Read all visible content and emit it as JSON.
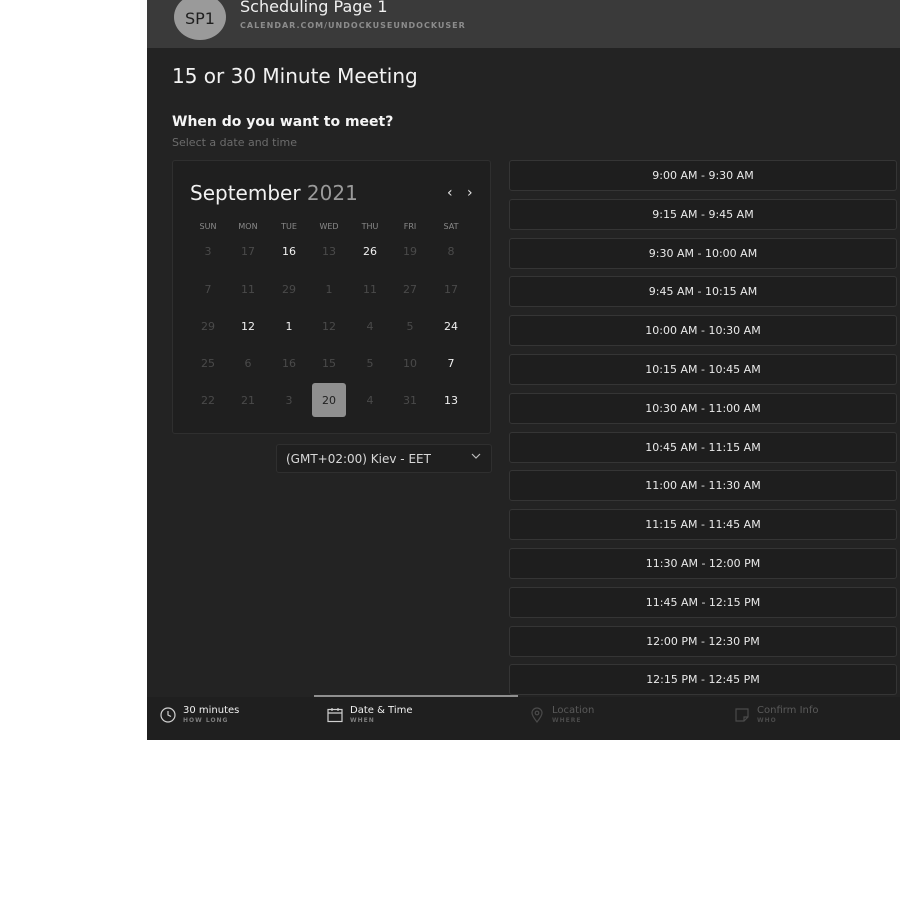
{
  "header": {
    "avatar_initials": "SP1",
    "title": "Scheduling Page 1",
    "url": "CALENDAR.COM/UNDOCKUSEUNDOCKUSER"
  },
  "page_title": "15 or 30 Minute Meeting",
  "question": "When do you want to meet?",
  "subtitle": "Select a date and time",
  "calendar": {
    "month": "September",
    "year": "2021",
    "prev_icon": "‹",
    "next_icon": "›",
    "weekdays": [
      "SUN",
      "MON",
      "TUE",
      "WED",
      "THU",
      "FRI",
      "SAT"
    ],
    "selected": "20",
    "weeks": [
      [
        {
          "d": "3",
          "a": false
        },
        {
          "d": "17",
          "a": false
        },
        {
          "d": "16",
          "a": true
        },
        {
          "d": "13",
          "a": false
        },
        {
          "d": "26",
          "a": true
        },
        {
          "d": "19",
          "a": false
        },
        {
          "d": "8",
          "a": false
        }
      ],
      [
        {
          "d": "7",
          "a": false
        },
        {
          "d": "11",
          "a": false
        },
        {
          "d": "29",
          "a": false
        },
        {
          "d": "1",
          "a": false
        },
        {
          "d": "11",
          "a": false
        },
        {
          "d": "27",
          "a": false
        },
        {
          "d": "17",
          "a": false
        }
      ],
      [
        {
          "d": "29",
          "a": false
        },
        {
          "d": "12",
          "a": true
        },
        {
          "d": "1",
          "a": true
        },
        {
          "d": "12",
          "a": false
        },
        {
          "d": "4",
          "a": false
        },
        {
          "d": "5",
          "a": false
        },
        {
          "d": "24",
          "a": true
        }
      ],
      [
        {
          "d": "25",
          "a": false
        },
        {
          "d": "6",
          "a": false
        },
        {
          "d": "16",
          "a": false
        },
        {
          "d": "15",
          "a": false
        },
        {
          "d": "5",
          "a": false
        },
        {
          "d": "10",
          "a": false
        },
        {
          "d": "7",
          "a": true
        }
      ],
      [
        {
          "d": "22",
          "a": false
        },
        {
          "d": "21",
          "a": false
        },
        {
          "d": "3",
          "a": false
        },
        {
          "d": "20",
          "a": true,
          "s": true
        },
        {
          "d": "4",
          "a": false
        },
        {
          "d": "31",
          "a": false
        },
        {
          "d": "13",
          "a": true
        }
      ]
    ]
  },
  "timezone": {
    "label": "(GMT+02:00) Kiev - EET",
    "icon": "chevron-down-icon"
  },
  "time_slots": [
    "9:00 AM - 9:30 AM",
    "9:15 AM - 9:45 AM",
    "9:30 AM - 10:00 AM",
    "9:45 AM - 10:15 AM",
    "10:00 AM - 10:30 AM",
    "10:15 AM - 10:45 AM",
    "10:30 AM - 11:00 AM",
    "10:45 AM - 11:15 AM",
    "11:00 AM - 11:30 AM",
    "11:15 AM - 11:45 AM",
    "11:30 AM - 12:00 PM",
    "11:45 AM - 12:15 PM",
    "12:00 PM - 12:30 PM",
    "12:15 PM - 12:45 PM"
  ],
  "footer": {
    "steps": [
      {
        "title": "30 minutes",
        "sub": "HOW LONG",
        "icon": "clock-icon",
        "active": true
      },
      {
        "title": "Date & Time",
        "sub": "WHEN",
        "icon": "calendar-icon",
        "active": true
      },
      {
        "title": "Location",
        "sub": "WHERE",
        "icon": "location-pin-icon",
        "active": false
      },
      {
        "title": "Confirm Info",
        "sub": "WHO",
        "icon": "note-icon",
        "active": false
      }
    ]
  },
  "colors": {
    "background": "#232323",
    "header": "#3a3a3a",
    "accent": "#8f8f8f"
  }
}
